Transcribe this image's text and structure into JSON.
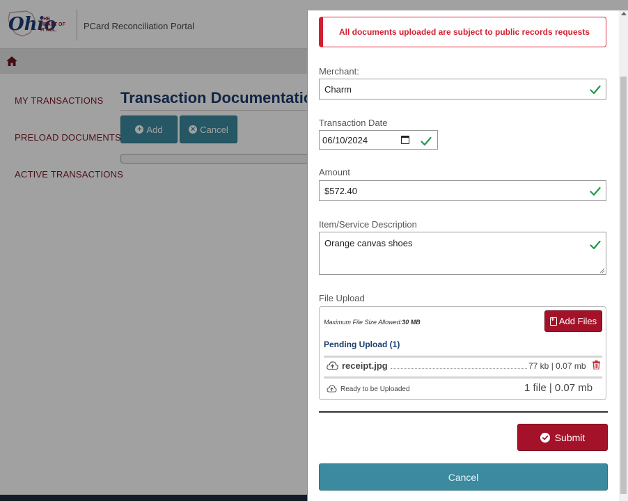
{
  "app": {
    "portal_title": "PCard Reconciliation Portal",
    "logo": {
      "word": "Ohio",
      "tagline": "THE HEART OF IT ALL."
    }
  },
  "nav": {
    "home_icon": "home-icon"
  },
  "sidebar": {
    "items": [
      {
        "label": "MY TRANSACTIONS"
      },
      {
        "label": "PRELOAD DOCUMENTS"
      },
      {
        "label": "ACTIVE TRANSACTIONS"
      }
    ]
  },
  "main": {
    "heading": "Transaction Documentation",
    "add_label": "Add",
    "cancel_label": "Cancel"
  },
  "modal": {
    "alert": "All documents uploaded are subject to public records requests",
    "merchant": {
      "label": "Merchant:",
      "value": "Charm"
    },
    "transaction_date": {
      "label": "Transaction Date",
      "value": "06/10/2024"
    },
    "amount": {
      "label": "Amount",
      "value": "$572.40"
    },
    "description": {
      "label": "Item/Service Description",
      "value": "Orange canvas shoes"
    },
    "file_upload": {
      "label": "File Upload",
      "max_size_label": "Maximum File Size Allowed:",
      "max_size_value": "30 MB",
      "add_files_label": "Add Files",
      "pending_title": "Pending Upload (1)",
      "files": [
        {
          "name": "receipt.jpg",
          "size": "77 kb | 0.07 mb"
        }
      ],
      "ready_text": "Ready to be Uploaded",
      "summary": "1 file | 0.07 mb"
    },
    "submit_label": "Submit",
    "cancel_label": "Cancel"
  },
  "colors": {
    "brand_red": "#a31228",
    "teal": "#3c8aa0",
    "navy": "#1c3d6e",
    "valid_green": "#1e9a4a",
    "alert_red": "#d21f2f"
  }
}
